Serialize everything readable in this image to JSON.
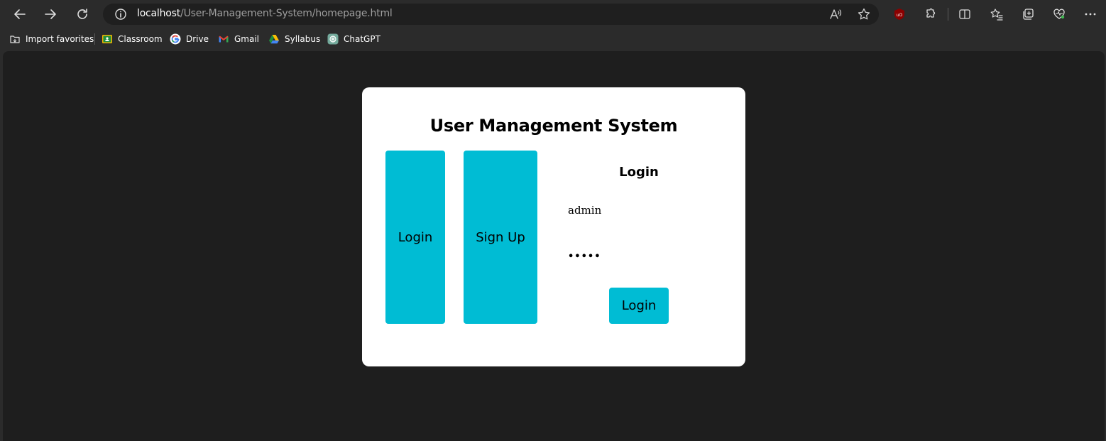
{
  "browser": {
    "url_host": "localhost",
    "url_path": "/User-Management-System/homepage.html",
    "bookmarks": [
      "Import favorites",
      "Classroom",
      "Drive",
      "Gmail",
      "Syllabus",
      "ChatGPT"
    ]
  },
  "page": {
    "title": "User Management System",
    "login_tile_label": "Login",
    "signup_tile_label": "Sign Up",
    "form": {
      "title": "Login",
      "username_value": "admin",
      "password_value": "•••••",
      "submit_label": "Login"
    }
  },
  "colors": {
    "accent": "#00bcd4",
    "card": "#ffffff",
    "page_background": "#1e1e1e",
    "chrome_background": "#2b2b2b"
  }
}
